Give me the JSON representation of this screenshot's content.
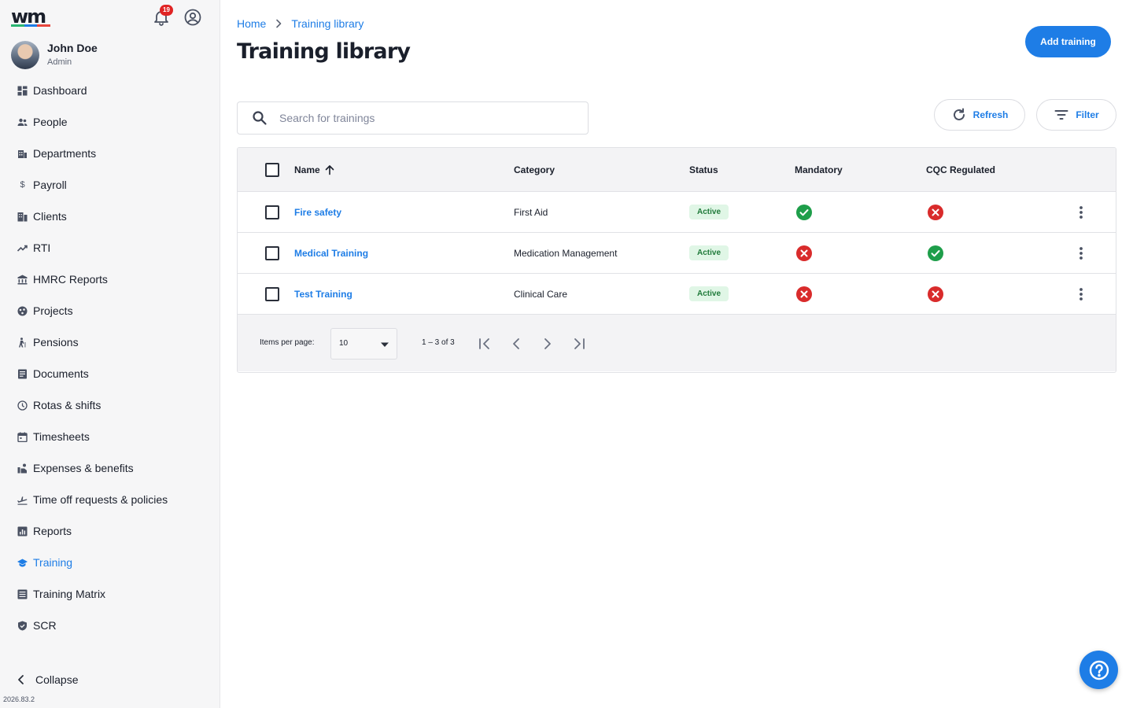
{
  "app": {
    "logo_text": "wm",
    "logo_colors": [
      "#2bb673",
      "#1e7de6",
      "#e8453c"
    ],
    "notifications_count": "19",
    "accent_color": "#1e7de6"
  },
  "user": {
    "name": "John Doe",
    "role": "Admin"
  },
  "sidebar": {
    "items": [
      {
        "label": "Dashboard",
        "icon": "dashboard-icon"
      },
      {
        "label": "People",
        "icon": "people-icon"
      },
      {
        "label": "Departments",
        "icon": "departments-icon"
      },
      {
        "label": "Payroll",
        "icon": "dollar-icon"
      },
      {
        "label": "Clients",
        "icon": "clients-icon"
      },
      {
        "label": "RTI",
        "icon": "trend-icon"
      },
      {
        "label": "HMRC Reports",
        "icon": "bank-icon"
      },
      {
        "label": "Projects",
        "icon": "projects-icon"
      },
      {
        "label": "Pensions",
        "icon": "pensions-icon"
      },
      {
        "label": "Documents",
        "icon": "document-icon"
      },
      {
        "label": "Rotas & shifts",
        "icon": "clock-icon"
      },
      {
        "label": "Timesheets",
        "icon": "calendar-icon"
      },
      {
        "label": "Expenses & benefits",
        "icon": "expenses-icon"
      },
      {
        "label": "Time off requests & policies",
        "icon": "plane-icon"
      },
      {
        "label": "Reports",
        "icon": "reports-icon"
      },
      {
        "label": "Training",
        "icon": "graduation-cap-icon"
      },
      {
        "label": "Training Matrix",
        "icon": "matrix-icon"
      },
      {
        "label": "SCR",
        "icon": "shield-icon"
      }
    ],
    "active": "Training",
    "collapse_label": "Collapse",
    "version": "2026.83.2"
  },
  "header": {
    "breadcrumb": [
      "Home",
      "Training library"
    ],
    "title": "Training library",
    "add_button": "Add training"
  },
  "toolbar": {
    "search_placeholder": "Search for trainings",
    "refresh_label": "Refresh",
    "filter_label": "Filter"
  },
  "table": {
    "columns": [
      "Name",
      "Category",
      "Status",
      "Mandatory",
      "CQC Regulated"
    ],
    "sort": {
      "column": "Name",
      "direction": "ascending"
    },
    "rows": [
      {
        "name": "Fire safety",
        "category": "First Aid",
        "status": "Active",
        "mandatory": true,
        "cqc": false
      },
      {
        "name": "Medical Training",
        "category": "Medication Management",
        "status": "Active",
        "mandatory": false,
        "cqc": true
      },
      {
        "name": "Test Training",
        "category": "Clinical Care",
        "status": "Active",
        "mandatory": false,
        "cqc": false
      }
    ]
  },
  "pagination": {
    "items_per_page_label": "Items per page:",
    "items_per_page": "10",
    "range": "1 – 3 of 3"
  }
}
